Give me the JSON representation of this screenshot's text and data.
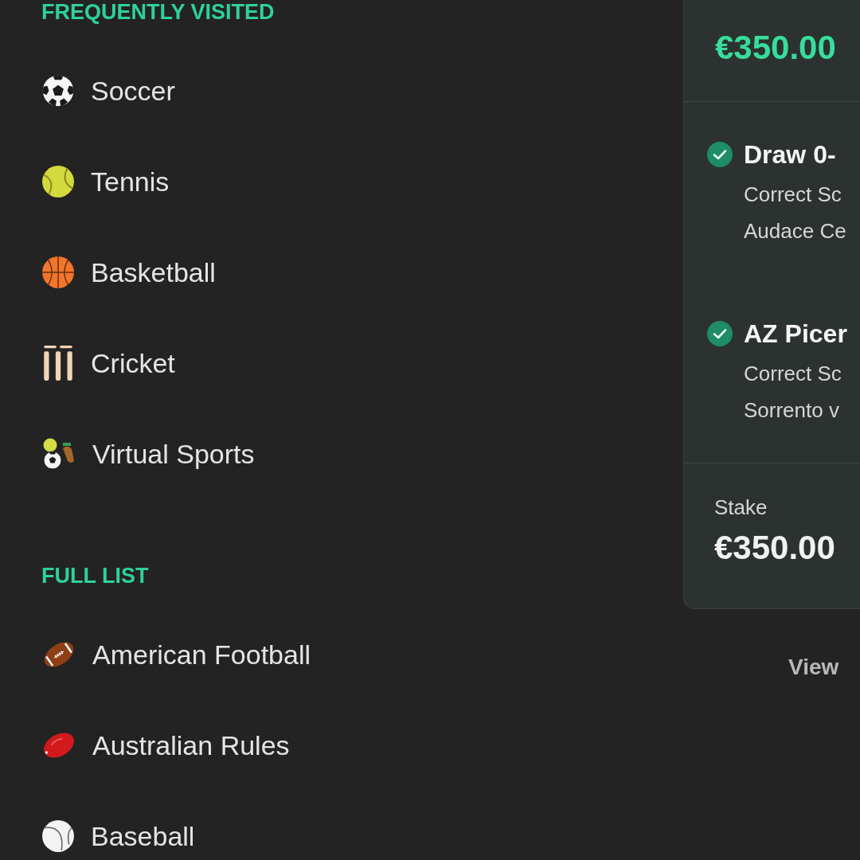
{
  "sidebar": {
    "sections": [
      {
        "heading": "FREQUENTLY VISITED",
        "items": [
          {
            "label": "Soccer",
            "kind": "soccer"
          },
          {
            "label": "Tennis",
            "kind": "tennis"
          },
          {
            "label": "Basketball",
            "kind": "basketball"
          },
          {
            "label": "Cricket",
            "kind": "cricket"
          },
          {
            "label": "Virtual Sports",
            "kind": "virtual"
          }
        ]
      },
      {
        "heading": "FULL LIST",
        "items": [
          {
            "label": "American Football",
            "kind": "american_football"
          },
          {
            "label": "Australian Rules",
            "kind": "australian_rules"
          },
          {
            "label": "Baseball",
            "kind": "baseball"
          }
        ]
      }
    ]
  },
  "bet_slip": {
    "amount": "€350.00",
    "selections": [
      {
        "won": true,
        "title": "Draw 0-",
        "market": "Correct Sc",
        "event": "Audace Ce"
      },
      {
        "won": true,
        "title": "AZ Picer",
        "market": "Correct Sc",
        "event": "Sorrento v"
      }
    ],
    "stake_label": "Stake",
    "stake": "€350.00",
    "link": "View"
  }
}
